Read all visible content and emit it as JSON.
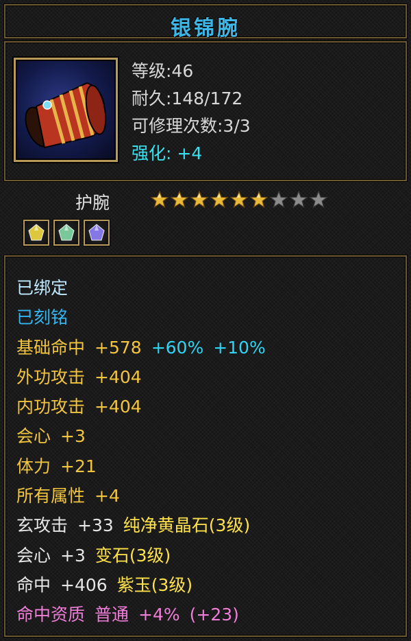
{
  "item": {
    "name": "银锦腕",
    "icon": "red-bracer-icon",
    "level": "等级:46",
    "durability": "耐久:148/172",
    "repair": "可修理次数:3/3",
    "enhance_label": "强化:",
    "enhance_value": "+4"
  },
  "type": {
    "label": "护腕",
    "stars_total": 9,
    "stars_filled": 6
  },
  "gems": [
    {
      "icon": "yellow-gem-icon",
      "color": "#e8d040"
    },
    {
      "icon": "green-gem-icon",
      "color": "#7fd0a0"
    },
    {
      "icon": "purple-gem-icon",
      "color": "#8a7cf0"
    }
  ],
  "status": {
    "bound": "已绑定",
    "engraved": "已刻铭"
  },
  "attrs": {
    "hit": {
      "label": "基础命中",
      "base": "+578",
      "bonus1": "+60%",
      "bonus2": "+10%"
    },
    "outer_attack": {
      "label": "外功攻击",
      "value": "+404"
    },
    "inner_attack": {
      "label": "内功攻击",
      "value": "+404"
    },
    "crit": {
      "label": "会心",
      "value": "+3"
    },
    "stamina": {
      "label": "体力",
      "value": "+21"
    },
    "all_attrs": {
      "label": "所有属性",
      "value": "+4"
    }
  },
  "gem_attrs": [
    {
      "label": "玄攻击",
      "value": "+33",
      "gem": "纯净黄晶石(3级)"
    },
    {
      "label": "会心",
      "value": "+3",
      "gem": "变石(3级)"
    },
    {
      "label": "命中",
      "value": "+406",
      "gem": "紫玉(3级)"
    }
  ],
  "aptitude": {
    "label": "命中资质",
    "grade": "普通",
    "percent": "+4%",
    "amount": "(+23)"
  },
  "colors": {
    "title": "#3fb7e6",
    "enhance": "#39e0ee",
    "gold_attr": "#f3c53e",
    "aptitude": "#f07ed8"
  }
}
